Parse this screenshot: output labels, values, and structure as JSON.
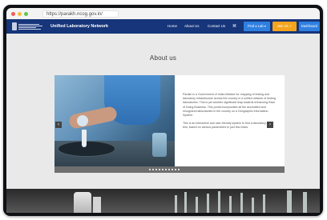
{
  "browser": {
    "url": "https://parakh.ncog.gov.in/",
    "traffic_light_colors": [
      "#ee5f57",
      "#f6bd3a",
      "#5fc650"
    ]
  },
  "nav": {
    "site_title": "Unified Laboratory Network",
    "links": [
      "Home",
      "About Us",
      "Contact Us"
    ],
    "accessibility_icon": "accessibility-icon",
    "buttons": {
      "find_lab": "Find a Lab ▾",
      "join_us": "Join Us ↗",
      "dashboard": "Dashboard"
    },
    "colors": {
      "bar": "#16357a",
      "find_lab": "#2f7fe0",
      "join_us": "#f4a41c",
      "dashboard": "#2f7fe0"
    }
  },
  "about": {
    "heading": "About us",
    "paragraphs": [
      "Parakh is a Government of India initiative for mapping of testing and laboratory infrastructure across the country in a unified network of testing laboratories. This is yet another significant leap towards enhancing Ease of Doing Business. This portal incorporates all the accredited and recognized laboratories in the country on a Geographic Information System.",
      "This is an interactive and user-friendly system to find a laboratory and test, based on various parameters in just few clicks."
    ],
    "carousel_next_icon": "chevron-right-icon",
    "carousel_prev_icon": "chevron-left-icon",
    "slide_count": 10
  }
}
